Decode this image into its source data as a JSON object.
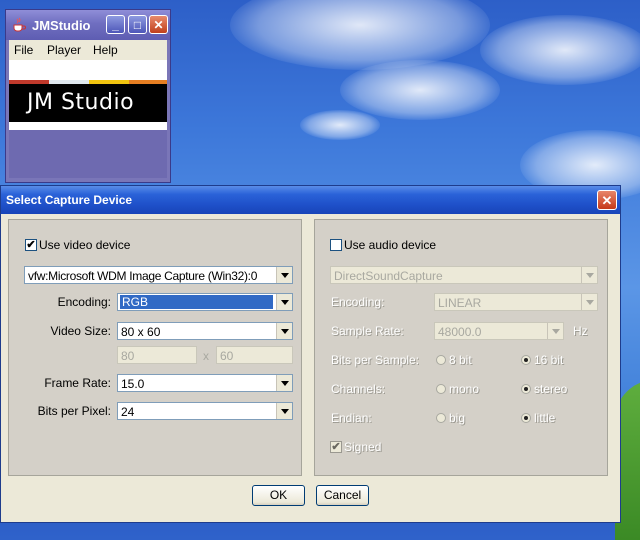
{
  "jmstudio": {
    "title": "JMStudio",
    "menu": [
      "File",
      "Player",
      "Help"
    ],
    "logo_text": "JM Studio",
    "controls": {
      "minimize": "_",
      "maximize": "□",
      "close": "✕"
    }
  },
  "dialog": {
    "title": "Select Capture Device",
    "close": "✕",
    "video": {
      "use_label": "Use video device",
      "use_checked": true,
      "device": "vfw:Microsoft WDM Image Capture (Win32):0",
      "encoding_label": "Encoding:",
      "encoding": "RGB",
      "size_label": "Video Size:",
      "size": "80 x 60",
      "width": "80",
      "x_sep": "x",
      "height": "60",
      "frame_rate_label": "Frame Rate:",
      "frame_rate": "15.0",
      "bpp_label": "Bits per Pixel:",
      "bpp": "24"
    },
    "audio": {
      "use_label": "Use audio device",
      "use_checked": false,
      "device": "DirectSoundCapture",
      "encoding_label": "Encoding:",
      "encoding": "LINEAR",
      "sample_rate_label": "Sample Rate:",
      "sample_rate": "48000.0",
      "hz": "Hz",
      "bits_label": "Bits per Sample:",
      "bits_options": [
        "8 bit",
        "16 bit"
      ],
      "bits_selected": "16 bit",
      "channels_label": "Channels:",
      "channels_options": [
        "mono",
        "stereo"
      ],
      "channels_selected": "stereo",
      "endian_label": "Endian:",
      "endian_options": [
        "big",
        "little"
      ],
      "endian_selected": "little",
      "signed_label": "Signed",
      "signed_checked": true
    },
    "ok": "OK",
    "cancel": "Cancel"
  },
  "colors": {
    "title_blue": "#2a62d8",
    "dialog_bg": "#ece9d8",
    "selection": "#316ac5"
  }
}
